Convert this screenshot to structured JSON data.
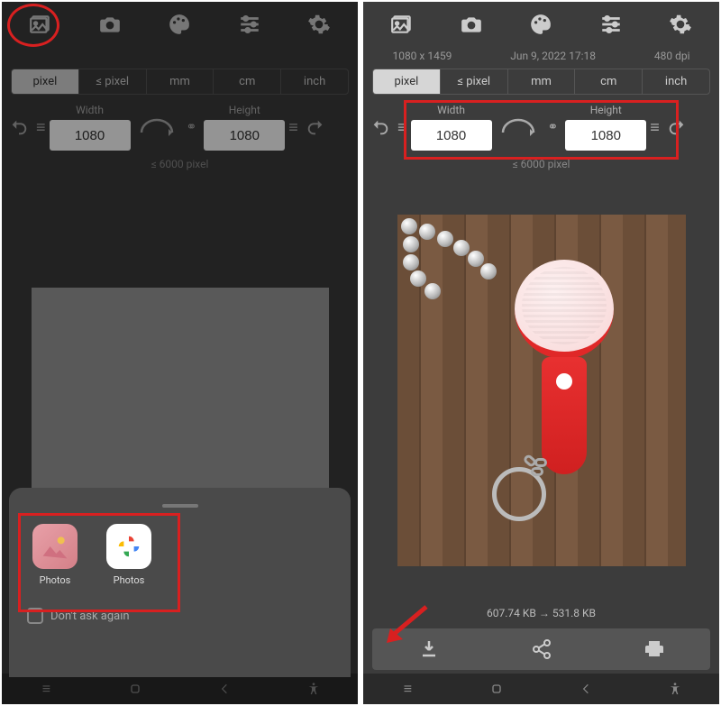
{
  "left": {
    "unit_tabs": [
      "pixel",
      "≤ pixel",
      "mm",
      "cm",
      "inch"
    ],
    "active_unit": "pixel",
    "width_label": "Width",
    "height_label": "Height",
    "width_value": "1080",
    "height_value": "1080",
    "max_hint": "≤ 6000 pixel",
    "sheet_apps": [
      {
        "label": "Photos",
        "icon": "gallery-pink-icon"
      },
      {
        "label": "Photos",
        "icon": "google-photos-icon"
      }
    ],
    "dont_ask_label": "Don't ask again"
  },
  "right": {
    "meta": {
      "dimensions": "1080 x 1459",
      "date": "Jun 9, 2022 17:18",
      "dpi": "480 dpi"
    },
    "unit_tabs": [
      "pixel",
      "≤ pixel",
      "mm",
      "cm",
      "inch"
    ],
    "active_unit": "pixel",
    "width_label": "Width",
    "height_label": "Height",
    "width_value": "1080",
    "height_value": "1080",
    "max_hint": "≤ 6000 pixel",
    "size_info": "607.74 KB → 531.8 KB"
  }
}
